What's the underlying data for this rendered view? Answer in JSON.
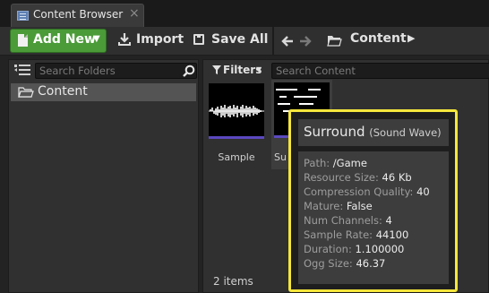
{
  "window": {
    "tab_title": "Content Browser",
    "tab_close": "×"
  },
  "toolbar": {
    "add_new_label": "Add New",
    "import_label": "Import",
    "save_all_label": "Save All",
    "back_glyph": "🡐",
    "forward_glyph": "🡒",
    "path_label": "Content",
    "path_caret": "▶"
  },
  "folders": {
    "search_placeholder": "Search Folders",
    "items": [
      {
        "label": "Content",
        "selected": true
      }
    ]
  },
  "content": {
    "filters_label": "Filters",
    "search_placeholder": "Search Content",
    "assets": [
      {
        "name": "Sample"
      },
      {
        "name": "Su",
        "hovered": true
      }
    ],
    "item_count": "2 items"
  },
  "tooltip": {
    "title": "Surround",
    "type": "(Sound Wave)",
    "rows": [
      {
        "key": "Path:",
        "value": "/Game"
      },
      {
        "key": "Resource Size:",
        "value": "46 Kb"
      },
      {
        "key": "Compression Quality:",
        "value": "40"
      },
      {
        "key": "Mature:",
        "value": "False"
      },
      {
        "key": "Num Channels:",
        "value": "4"
      },
      {
        "key": "Sample Rate:",
        "value": "44100"
      },
      {
        "key": "Duration:",
        "value": "1.100000"
      },
      {
        "key": "Ogg Size:",
        "value": "46.37"
      }
    ]
  },
  "colors": {
    "accent_green": "#4b9b39",
    "highlight_yellow": "#f5e63c",
    "asset_underline": "#5b48c0"
  }
}
